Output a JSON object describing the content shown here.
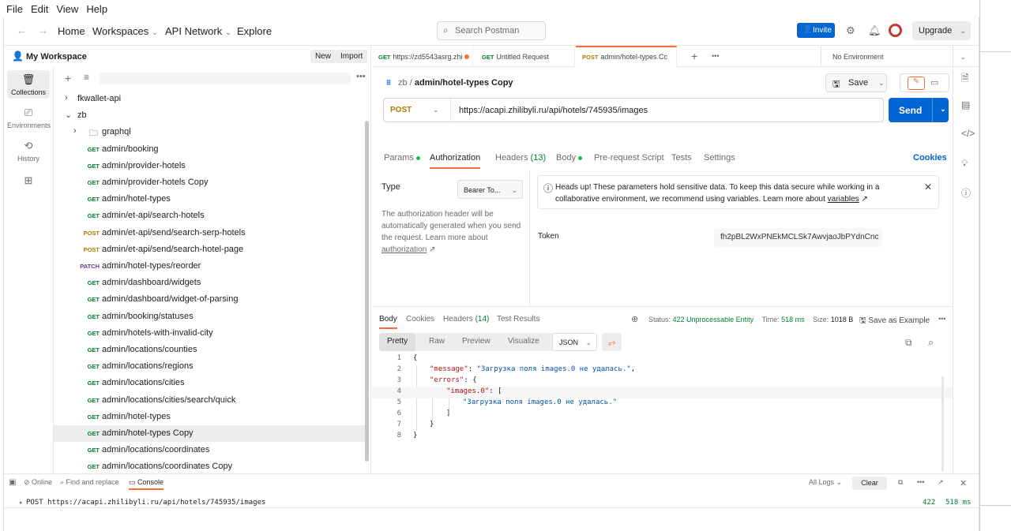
{
  "menubar": {
    "file": "File",
    "edit": "Edit",
    "view": "View",
    "help": "Help"
  },
  "header": {
    "back_icon": "arrow-left-icon",
    "forward_icon": "arrow-right-icon",
    "home": "Home",
    "workspaces": "Workspaces",
    "api_network": "API Network",
    "explore": "Explore",
    "search_placeholder": "Search Postman",
    "invite": "Invite",
    "upgrade": "Upgrade"
  },
  "sidebar": {
    "workspace_name": "My Workspace",
    "new_label": "New",
    "import_label": "Import",
    "rail": [
      {
        "label": "Collections",
        "icon": "collections-icon"
      },
      {
        "label": "Environments",
        "icon": "environments-icon"
      },
      {
        "label": "History",
        "icon": "history-icon"
      }
    ],
    "tree": [
      {
        "type": "collection",
        "label": "fkwallet-api",
        "arrow": "›"
      },
      {
        "type": "collection",
        "label": "zb",
        "arrow": "⌄"
      },
      {
        "type": "folder",
        "label": "graphql",
        "arrow": "›"
      },
      {
        "type": "request",
        "method": "GET",
        "label": "admin/booking"
      },
      {
        "type": "request",
        "method": "GET",
        "label": "admin/provider-hotels"
      },
      {
        "type": "request",
        "method": "GET",
        "label": "admin/provider-hotels Copy"
      },
      {
        "type": "request",
        "method": "GET",
        "label": "admin/hotel-types"
      },
      {
        "type": "request",
        "method": "GET",
        "label": "admin/et-api/search-hotels"
      },
      {
        "type": "request",
        "method": "POST",
        "label": "admin/et-api/send/search-serp-hotels"
      },
      {
        "type": "request",
        "method": "POST",
        "label": "admin/et-api/send/search-hotel-page"
      },
      {
        "type": "request",
        "method": "PATCH",
        "label": "admin/hotel-types/reorder"
      },
      {
        "type": "request",
        "method": "GET",
        "label": "admin/dashboard/widgets"
      },
      {
        "type": "request",
        "method": "GET",
        "label": "admin/dashboard/widget-of-parsing"
      },
      {
        "type": "request",
        "method": "GET",
        "label": "admin/booking/statuses"
      },
      {
        "type": "request",
        "method": "GET",
        "label": "admin/hotels-with-invalid-city"
      },
      {
        "type": "request",
        "method": "GET",
        "label": "admin/locations/counties"
      },
      {
        "type": "request",
        "method": "GET",
        "label": "admin/locations/regions"
      },
      {
        "type": "request",
        "method": "GET",
        "label": "admin/locations/cities"
      },
      {
        "type": "request",
        "method": "GET",
        "label": "admin/locations/cities/search/quick"
      },
      {
        "type": "request",
        "method": "GET",
        "label": "admin/hotel-types"
      },
      {
        "type": "request",
        "method": "GET",
        "label": "admin/hotel-types Copy",
        "selected": true
      },
      {
        "type": "request",
        "method": "GET",
        "label": "admin/locations/coordinates"
      },
      {
        "type": "request",
        "method": "GET",
        "label": "admin/locations/coordinates Copy"
      }
    ]
  },
  "tabs": [
    {
      "method": "GET",
      "label": "https://zd5543asrg.zhi",
      "dot": true
    },
    {
      "method": "GET",
      "label": "Untitled Request",
      "dot": false
    },
    {
      "method": "POST",
      "label": "admin/hotel-types Cc",
      "dot": false,
      "active": true
    }
  ],
  "environment": "No Environment",
  "request": {
    "breadcrumb_parent": "zb",
    "breadcrumb_sep": "/",
    "name": "admin/hotel-types Copy",
    "save": "Save",
    "method": "POST",
    "url": "https://acapi.zhilibyli.ru/api/hotels/745935/images",
    "send": "Send",
    "tabs": {
      "params": "Params",
      "authorization": "Authorization",
      "headers": "Headers",
      "headers_count": "(13)",
      "body": "Body",
      "prerequest": "Pre-request Script",
      "tests": "Tests",
      "settings": "Settings",
      "cookies": "Cookies"
    },
    "auth": {
      "type_label": "Type",
      "type_value": "Bearer To...",
      "desc": "The authorization header will be automatically generated when you send the request. Learn more about",
      "desc_link": "authorization",
      "notice": "Heads up! These parameters hold sensitive data. To keep this data secure while working in a collaborative environment, we recommend using variables. Learn more about",
      "notice_link": "variables",
      "token_label": "Token",
      "token_value": "fh2pBL2WxPNEkMCLSk7AwvjaoJbPYdnCnc"
    }
  },
  "response": {
    "tabs": {
      "body": "Body",
      "cookies": "Cookies",
      "headers": "Headers",
      "headers_count": "(14)",
      "tests": "Test Results"
    },
    "status_label": "Status:",
    "status_value": "422 Unprocessable Entity",
    "time_label": "Time:",
    "time_value": "518 ms",
    "size_label": "Size:",
    "size_value": "1018 B",
    "save_example": "Save as Example",
    "views": {
      "pretty": "Pretty",
      "raw": "Raw",
      "preview": "Preview",
      "visualize": "Visualize"
    },
    "format": "JSON",
    "code_lines": [
      {
        "n": "1",
        "text": "{"
      },
      {
        "n": "2",
        "key": "\"message\"",
        "rest": ": ",
        "str": "\"Загрузка поля images.0 не удалась.\"",
        "end": ","
      },
      {
        "n": "3",
        "key": "\"errors\"",
        "rest": ": {"
      },
      {
        "n": "4",
        "key": "\"images.0\"",
        "rest": ": ["
      },
      {
        "n": "5",
        "str": "\"Загрузка поля images.0 не удалась.\""
      },
      {
        "n": "6",
        "text": "]"
      },
      {
        "n": "7",
        "text": "}"
      },
      {
        "n": "8",
        "text": "}"
      }
    ]
  },
  "bottom": {
    "online": "Online",
    "find_replace": "Find and replace",
    "console": "Console",
    "all_logs": "All Logs",
    "clear": "Clear",
    "console_entry": "POST https://acapi.zhilibyli.ru/api/hotels/745935/images",
    "console_status": "422",
    "console_time": "518 ms"
  }
}
